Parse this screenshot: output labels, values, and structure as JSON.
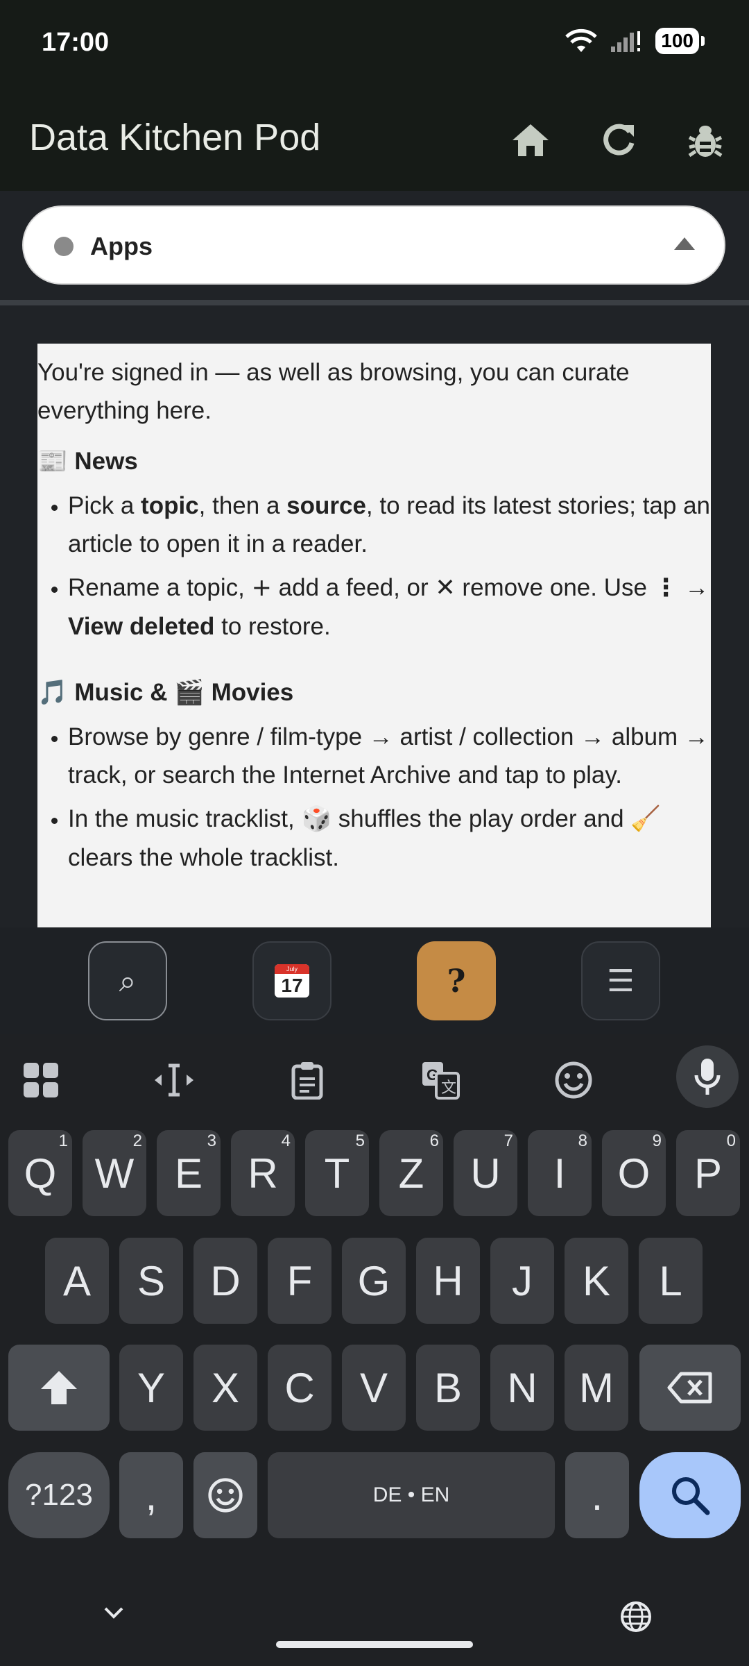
{
  "status_bar": {
    "time": "17:00",
    "battery": "100"
  },
  "app_bar": {
    "title": "Data Kitchen Pod"
  },
  "selector": {
    "label": "Apps"
  },
  "info": {
    "intro": "You're signed in — as well as browsing, you can curate everything here.",
    "news": {
      "icon": "📰",
      "title": "News",
      "b1": {
        "t1": "Pick a ",
        "topic": "topic",
        "t2": ", then a ",
        "source": "source",
        "t3": ", to read its latest stories; tap an article to open it in a reader."
      },
      "b2": {
        "t1": "Rename a topic, ",
        "plus": "+",
        "t2": " add a feed, or ",
        "cross": "✕",
        "t3": " remove one. Use ",
        "dots": "⋮",
        "arrow": " → ",
        "view_deleted": "View deleted",
        "t4": " to restore."
      }
    },
    "media": {
      "music_icon": "🎵",
      "music_title": "Music & ",
      "movie_icon": "🎬",
      "movie_title": "Movies",
      "b1": "Browse by genre / film-type → artist / collection → album → track, or search the Internet Archive and tap to play.",
      "b2": {
        "t1": "In the music tracklist, ",
        "dice": "🎲",
        "t2": " shuffles the play order and ",
        "broom": "🧹",
        "t3": " clears the whole tracklist."
      }
    }
  },
  "toolbar": {
    "search_icon": "⌕",
    "calendar": {
      "month": "July",
      "day": "17"
    },
    "help_label": "?",
    "menu_icon": "☰",
    "active": "help"
  },
  "keyboard": {
    "row1": [
      {
        "k": "Q",
        "h": "1"
      },
      {
        "k": "W",
        "h": "2"
      },
      {
        "k": "E",
        "h": "3"
      },
      {
        "k": "R",
        "h": "4"
      },
      {
        "k": "T",
        "h": "5"
      },
      {
        "k": "Z",
        "h": "6"
      },
      {
        "k": "U",
        "h": "7"
      },
      {
        "k": "I",
        "h": "8"
      },
      {
        "k": "O",
        "h": "9"
      },
      {
        "k": "P",
        "h": "0"
      }
    ],
    "row2": [
      "A",
      "S",
      "D",
      "F",
      "G",
      "H",
      "J",
      "K",
      "L"
    ],
    "row3": [
      "Y",
      "X",
      "C",
      "V",
      "B",
      "N",
      "M"
    ],
    "symbols_label": "?123",
    "comma": ",",
    "space_label": "DE • EN",
    "period": "."
  },
  "colors": {
    "help_accent": "#c58b45",
    "search_key": "#a8c7fa"
  }
}
